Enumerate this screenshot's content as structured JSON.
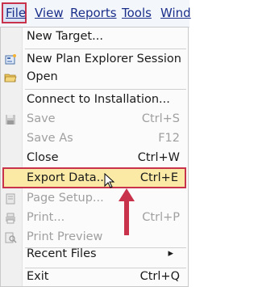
{
  "menubar": {
    "items": [
      "File",
      "View",
      "Reports",
      "Tools",
      "Wind"
    ]
  },
  "menu": {
    "new_target": "New Target...",
    "new_plan_explorer": "New Plan Explorer Session",
    "open": "Open",
    "connect": "Connect to Installation...",
    "save": {
      "label": "Save",
      "shortcut": "Ctrl+S"
    },
    "save_as": {
      "label": "Save As",
      "shortcut": "F12"
    },
    "close": {
      "label": "Close",
      "shortcut": "Ctrl+W"
    },
    "export": {
      "label": "Export Data...",
      "shortcut": "Ctrl+E"
    },
    "page_setup": "Page Setup...",
    "print": {
      "label": "Print...",
      "shortcut": "Ctrl+P"
    },
    "print_preview": "Print Preview",
    "recent_files": "Recent Files",
    "exit": {
      "label": "Exit",
      "shortcut": "Ctrl+Q"
    }
  },
  "colors": {
    "highlight": "#fbe9a6",
    "annotation": "#c8324a"
  }
}
